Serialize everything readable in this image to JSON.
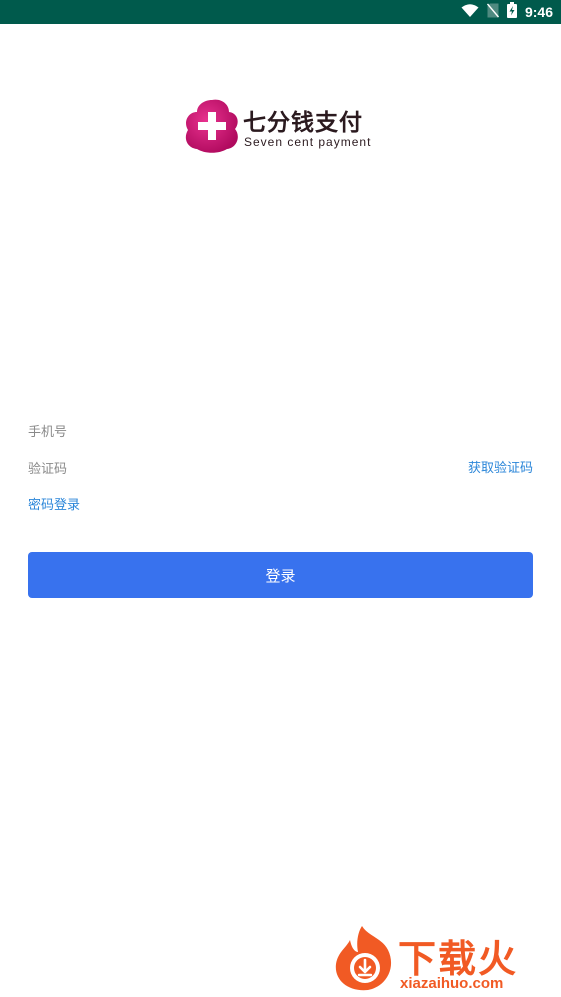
{
  "status_bar": {
    "time": "9:46",
    "icons": [
      "wifi-icon",
      "no-sim-icon",
      "battery-charging-icon"
    ]
  },
  "logo": {
    "title": "七分钱支付",
    "subtitle": "Seven cent payment"
  },
  "form": {
    "phone_placeholder": "手机号",
    "code_placeholder": "验证码",
    "get_code_label": "获取验证码",
    "password_login_label": "密码登录",
    "login_button_label": "登录"
  },
  "watermark": {
    "title": "下载火",
    "url": "xiazaihuo.com"
  },
  "colors": {
    "status_bar": "#005a4c",
    "primary_button": "#3872ee",
    "link": "#2b86d9",
    "logo_mark": "#c8126f",
    "watermark": "#f15a24"
  }
}
